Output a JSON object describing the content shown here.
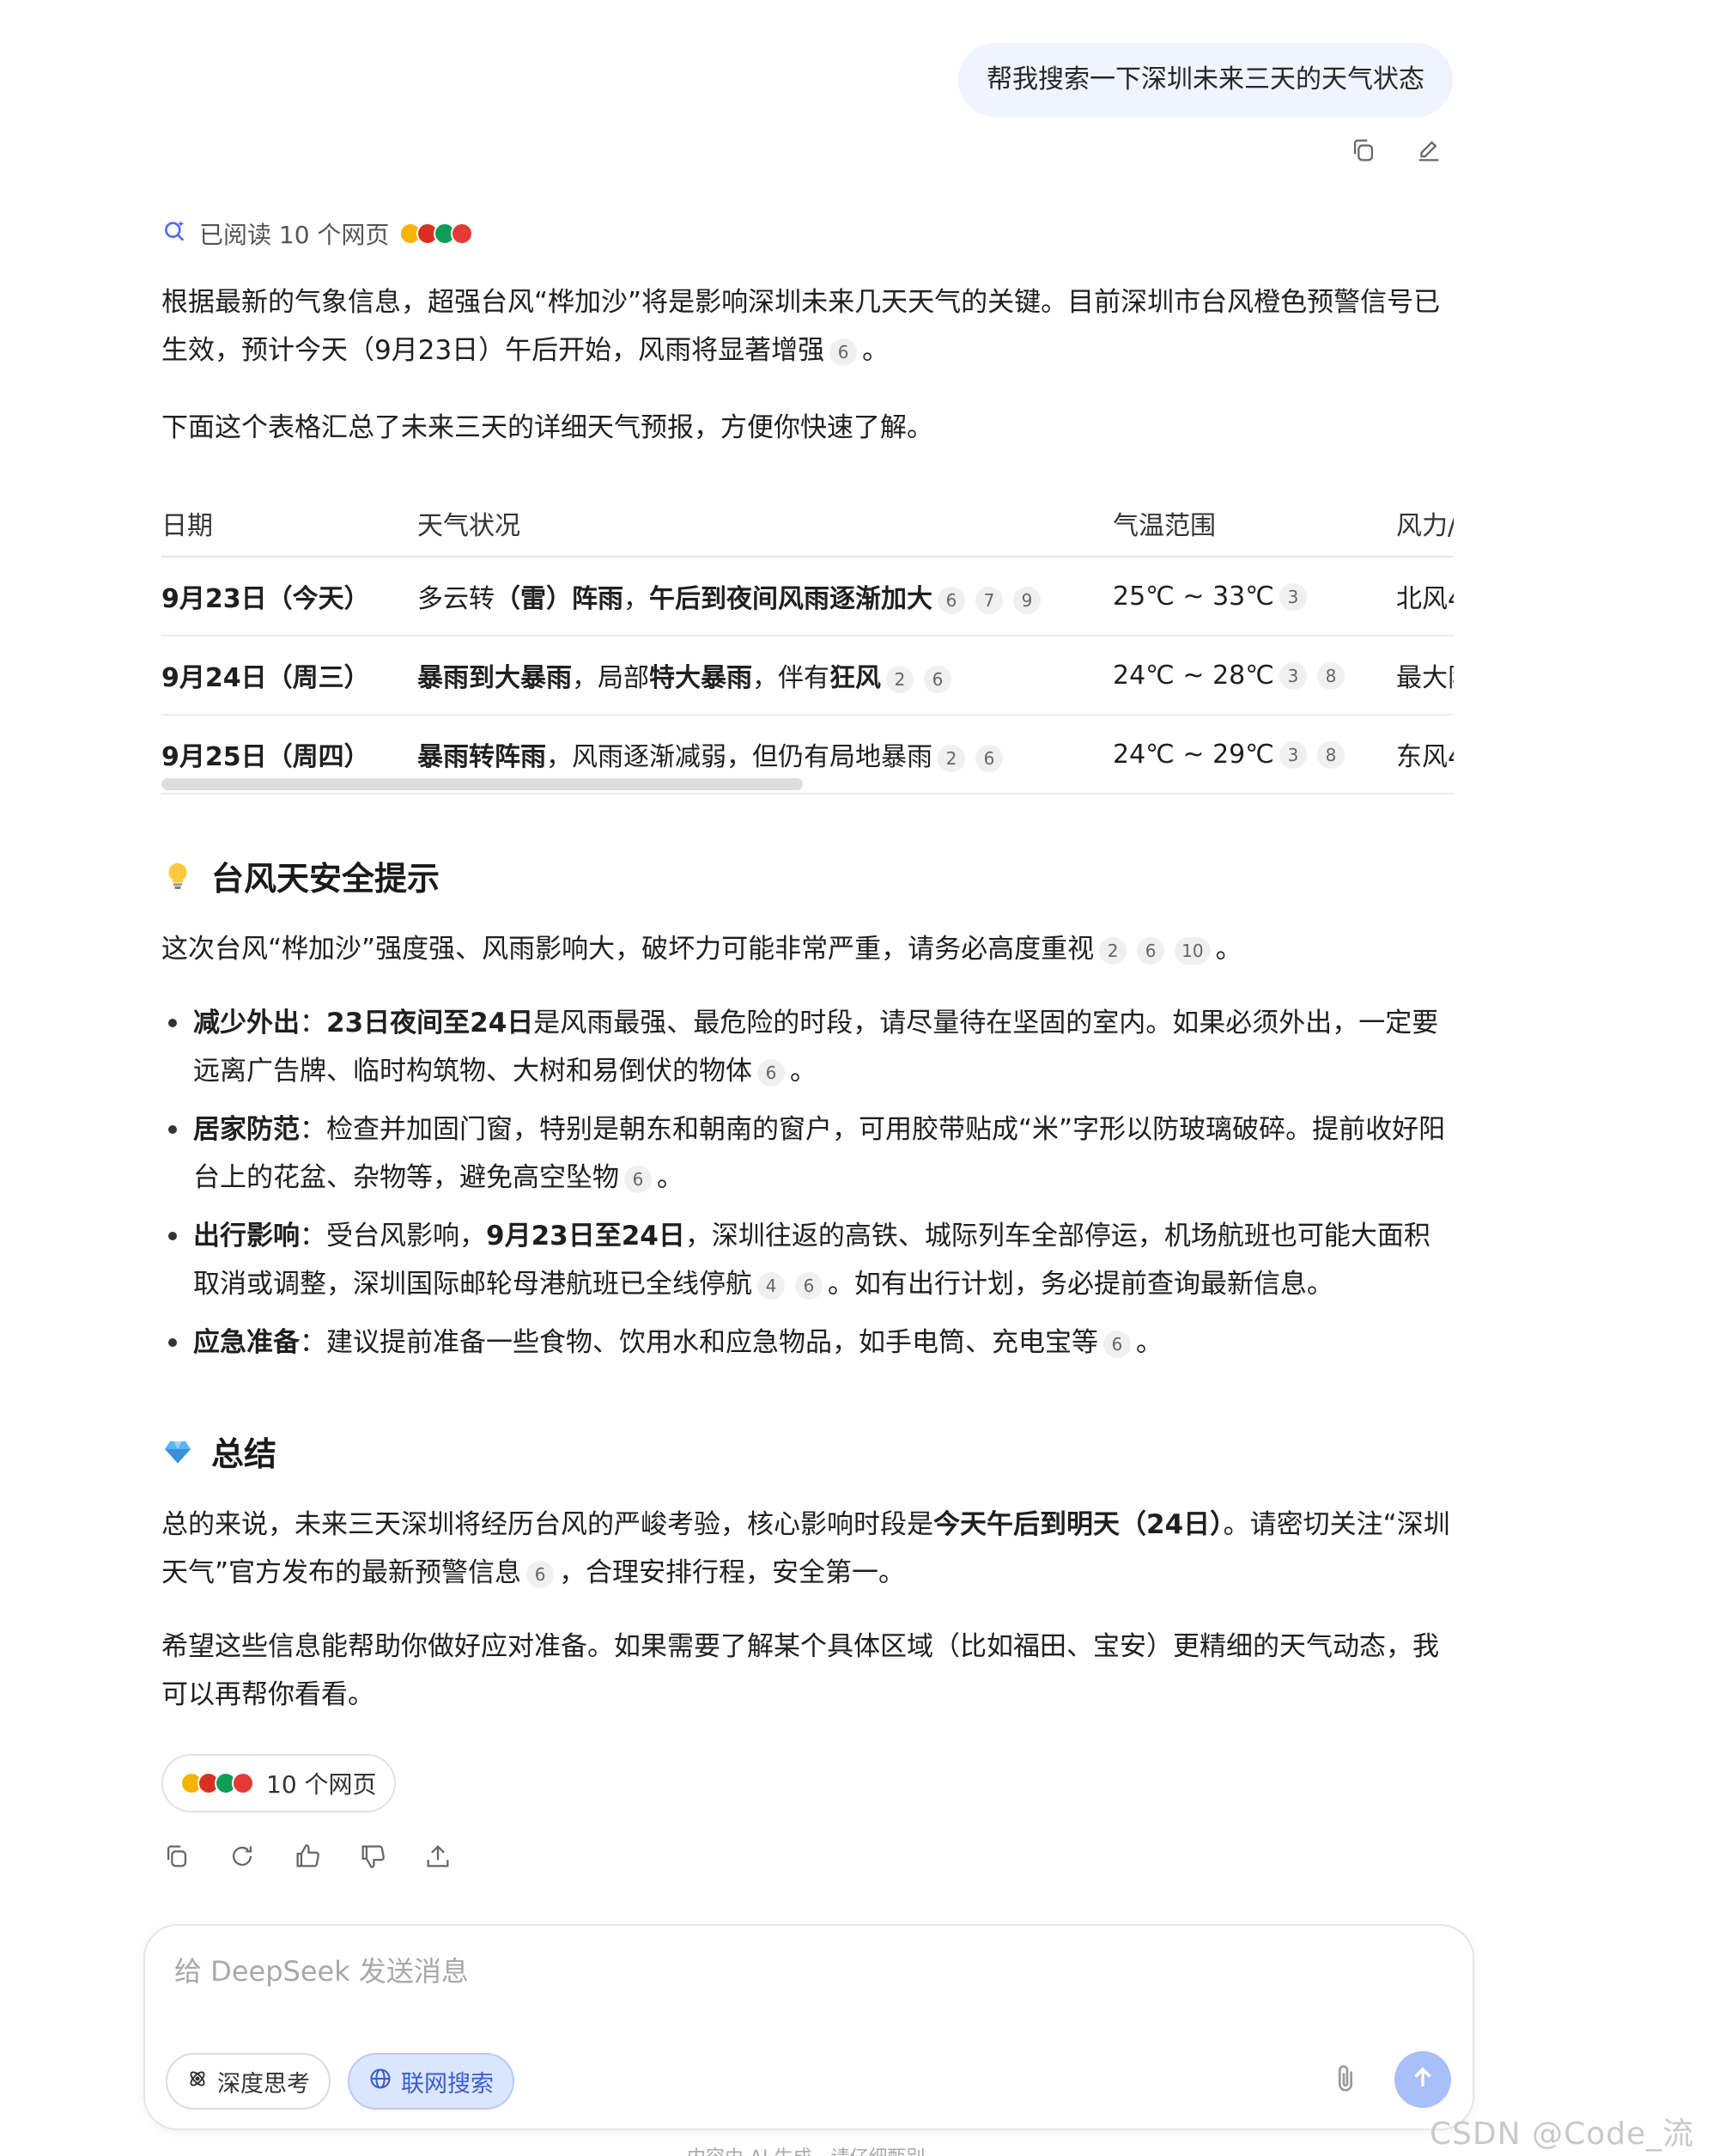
{
  "user_message": "帮我搜索一下深圳未来三天的天气状态",
  "read_status": "已阅读 10 个网页",
  "colors": {
    "accent": "#4d6bfe",
    "bubble": "#eff4ff",
    "citation_bg": "#f0f0f0"
  },
  "intro": {
    "p1_a": "根据最新的气象信息，超强台风“桦加沙”将是影响深圳未来几天天气的关键。目前深圳市台风橙色预警信号已生效，预计今天（9月23日）午后开始，风雨将显著增强",
    "p1_cite": "6",
    "p1_end": "。",
    "p2": "下面这个表格汇总了未来三天的详细天气预报，方便你快速了解。"
  },
  "table": {
    "headers": [
      "日期",
      "天气状况",
      "气温范围",
      "风力/"
    ],
    "rows": [
      {
        "date": "9月23日（今天）",
        "w1": "多云转",
        "w2": "（雷）阵雨",
        "w3": "，",
        "w4": "午后到夜间风雨逐渐加大",
        "w5": "",
        "w6": "",
        "cites": [
          "6",
          "7",
          "9"
        ],
        "temp": "25℃ ~ 33℃",
        "tcites": [
          "3"
        ],
        "wind": "北风4"
      },
      {
        "date": "9月24日（周三）",
        "w1": "",
        "w2": "暴雨到大暴雨",
        "w3": "，局部",
        "w4": "特大暴雨",
        "w5": "，伴有",
        "w6": "狂风",
        "cites": [
          "2",
          "6"
        ],
        "temp": "24℃ ~ 28℃",
        "tcites": [
          "3",
          "8"
        ],
        "wind": "最大阵"
      },
      {
        "date": "9月25日（周四）",
        "w1": "",
        "w2": "暴雨转阵雨",
        "w3": "，风雨逐渐减弱，但仍有局地暴雨",
        "w4": "",
        "w5": "",
        "w6": "",
        "cites": [
          "2",
          "6"
        ],
        "temp": "24℃ ~ 29℃",
        "tcites": [
          "3",
          "8"
        ],
        "wind": "东风4"
      }
    ]
  },
  "safety": {
    "heading": "台风天安全提示",
    "intro": "这次台风“桦加沙”强度强、风雨影响大，破坏力可能非常严重，请务必高度重视",
    "intro_cites": [
      "2",
      "6",
      "10"
    ],
    "items": [
      {
        "title": "减少外出",
        "sep": "：",
        "bold": "23日夜间至24日",
        "text": "是风雨最强、最危险的时段，请尽量待在坚固的室内。如果必须外出，一定要远离广告牌、临时构筑物、大树和易倒伏的物体",
        "cites": [
          "6"
        ],
        "tail": "。"
      },
      {
        "title": "居家防范",
        "sep": "：",
        "bold": "",
        "text": "检查并加固门窗，特别是朝东和朝南的窗户，可用胶带贴成“米”字形以防玻璃破碎。提前收好阳台上的花盆、杂物等，避免高空坠物",
        "cites": [
          "6"
        ],
        "tail": "。"
      },
      {
        "title": "出行影响",
        "sep": "：受台风影响，",
        "bold": "9月23日至24日",
        "text": "，深圳往返的高铁、城际列车全部停运，机场航班也可能大面积取消或调整，深圳国际邮轮母港航班已全线停航",
        "cites": [
          "4",
          "6"
        ],
        "tail": "。如有出行计划，务必提前查询最新信息。"
      },
      {
        "title": "应急准备",
        "sep": "：",
        "bold": "",
        "text": "建议提前准备一些食物、饮用水和应急物品，如手电筒、充电宝等",
        "cites": [
          "6"
        ],
        "tail": "。"
      }
    ]
  },
  "summary": {
    "heading": "总结",
    "p1_a": "总的来说，未来三天深圳将经历台风的严峻考验，核心影响时段是",
    "p1_bold": "今天午后到明天（24日）",
    "p1_b": "。请密切关注“深圳天气”官方发布的最新预警信息",
    "p1_cite": "6",
    "p1_c": "，合理安排行程，安全第一。",
    "p2": "希望这些信息能帮助你做好应对准备。如果需要了解某个具体区域（比如福田、宝安）更精细的天气动态，我可以再帮你看看。"
  },
  "sources_pill": "10 个网页",
  "composer": {
    "placeholder": "给 DeepSeek 发送消息",
    "deep_think": "深度思考",
    "web_search": "联网搜索"
  },
  "disclaimer": "内容由 AI 生成，请仔细甄别",
  "watermark": "CSDN @Code_流苏",
  "icons": [
    "copy-icon",
    "edit-icon",
    "search-spark-icon",
    "lightbulb-icon",
    "diamond-icon",
    "regenerate-icon",
    "thumbs-up-icon",
    "thumbs-down-icon",
    "share-icon",
    "deep-think-icon",
    "globe-icon",
    "paperclip-icon",
    "send-arrow-icon"
  ]
}
